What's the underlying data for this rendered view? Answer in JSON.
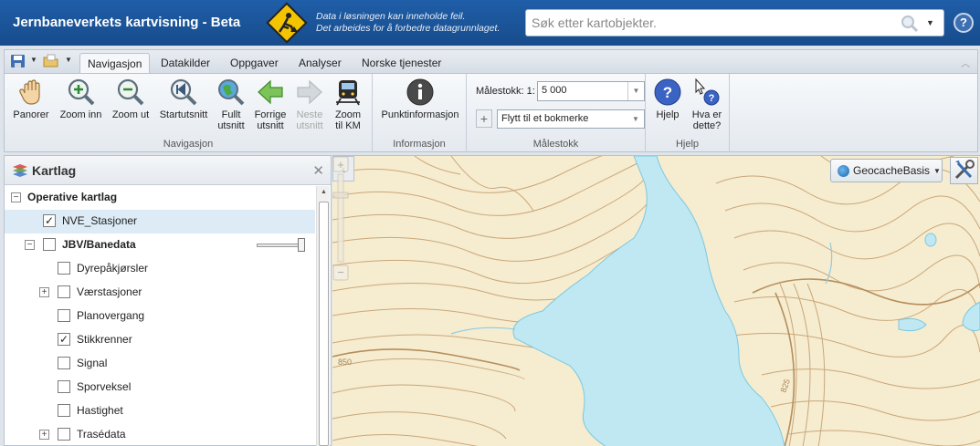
{
  "header": {
    "title": "Jernbaneverkets kartvisning - Beta",
    "notice_line1": "Data i løsningen kan inneholde feil.",
    "notice_line2": "Det arbeides for å forbedre datagrunnlaget.",
    "search_placeholder": "Søk etter kartobjekter.",
    "help_label": "?"
  },
  "ribbon": {
    "tabs": [
      {
        "label": "Navigasjon",
        "active": true
      },
      {
        "label": "Datakilder"
      },
      {
        "label": "Oppgaver"
      },
      {
        "label": "Analyser"
      },
      {
        "label": "Norske tjenester"
      }
    ],
    "nav_buttons": [
      {
        "line1": "Panorer",
        "line2": ""
      },
      {
        "line1": "Zoom inn",
        "line2": ""
      },
      {
        "line1": "Zoom ut",
        "line2": ""
      },
      {
        "line1": "Startutsnitt",
        "line2": ""
      },
      {
        "line1": "Fullt",
        "line2": "utsnitt"
      },
      {
        "line1": "Forrige",
        "line2": "utsnitt"
      },
      {
        "line1": "Neste",
        "line2": "utsnitt"
      },
      {
        "line1": "Zoom",
        "line2": "til KM"
      }
    ],
    "groups": {
      "navigation": "Navigasjon",
      "information": "Informasjon",
      "scale": "Målestokk",
      "help": "Hjelp"
    },
    "info_button": "Punktinformasjon",
    "scale_label": "Målestokk: 1:",
    "scale_value": "5 000",
    "bookmark_placeholder": "Flytt til et bokmerke",
    "help_button": "Hjelp",
    "whatis_line1": "Hva er",
    "whatis_line2": "dette?"
  },
  "layers": {
    "title": "Kartlag",
    "rows": [
      {
        "label": "Operative kartlag",
        "checked": null
      },
      {
        "label": "NVE_Stasjoner",
        "checked": true
      },
      {
        "label": "JBV/Banedata",
        "checked": false
      },
      {
        "label": "Dyrepåkjørsler",
        "checked": false
      },
      {
        "label": "Værstasjoner",
        "checked": false
      },
      {
        "label": "Planovergang",
        "checked": false
      },
      {
        "label": "Stikkrenner",
        "checked": true
      },
      {
        "label": "Signal",
        "checked": false
      },
      {
        "label": "Sporveksel",
        "checked": false
      },
      {
        "label": "Hastighet",
        "checked": false
      },
      {
        "label": "Trasédata",
        "checked": false
      }
    ]
  },
  "map": {
    "basemap": "GeocacheBasis",
    "contour_labels": [
      "850",
      "825"
    ],
    "colors": {
      "land": "#f6eccf",
      "water": "#bfe8f2",
      "contour": "#c9a77a"
    }
  }
}
